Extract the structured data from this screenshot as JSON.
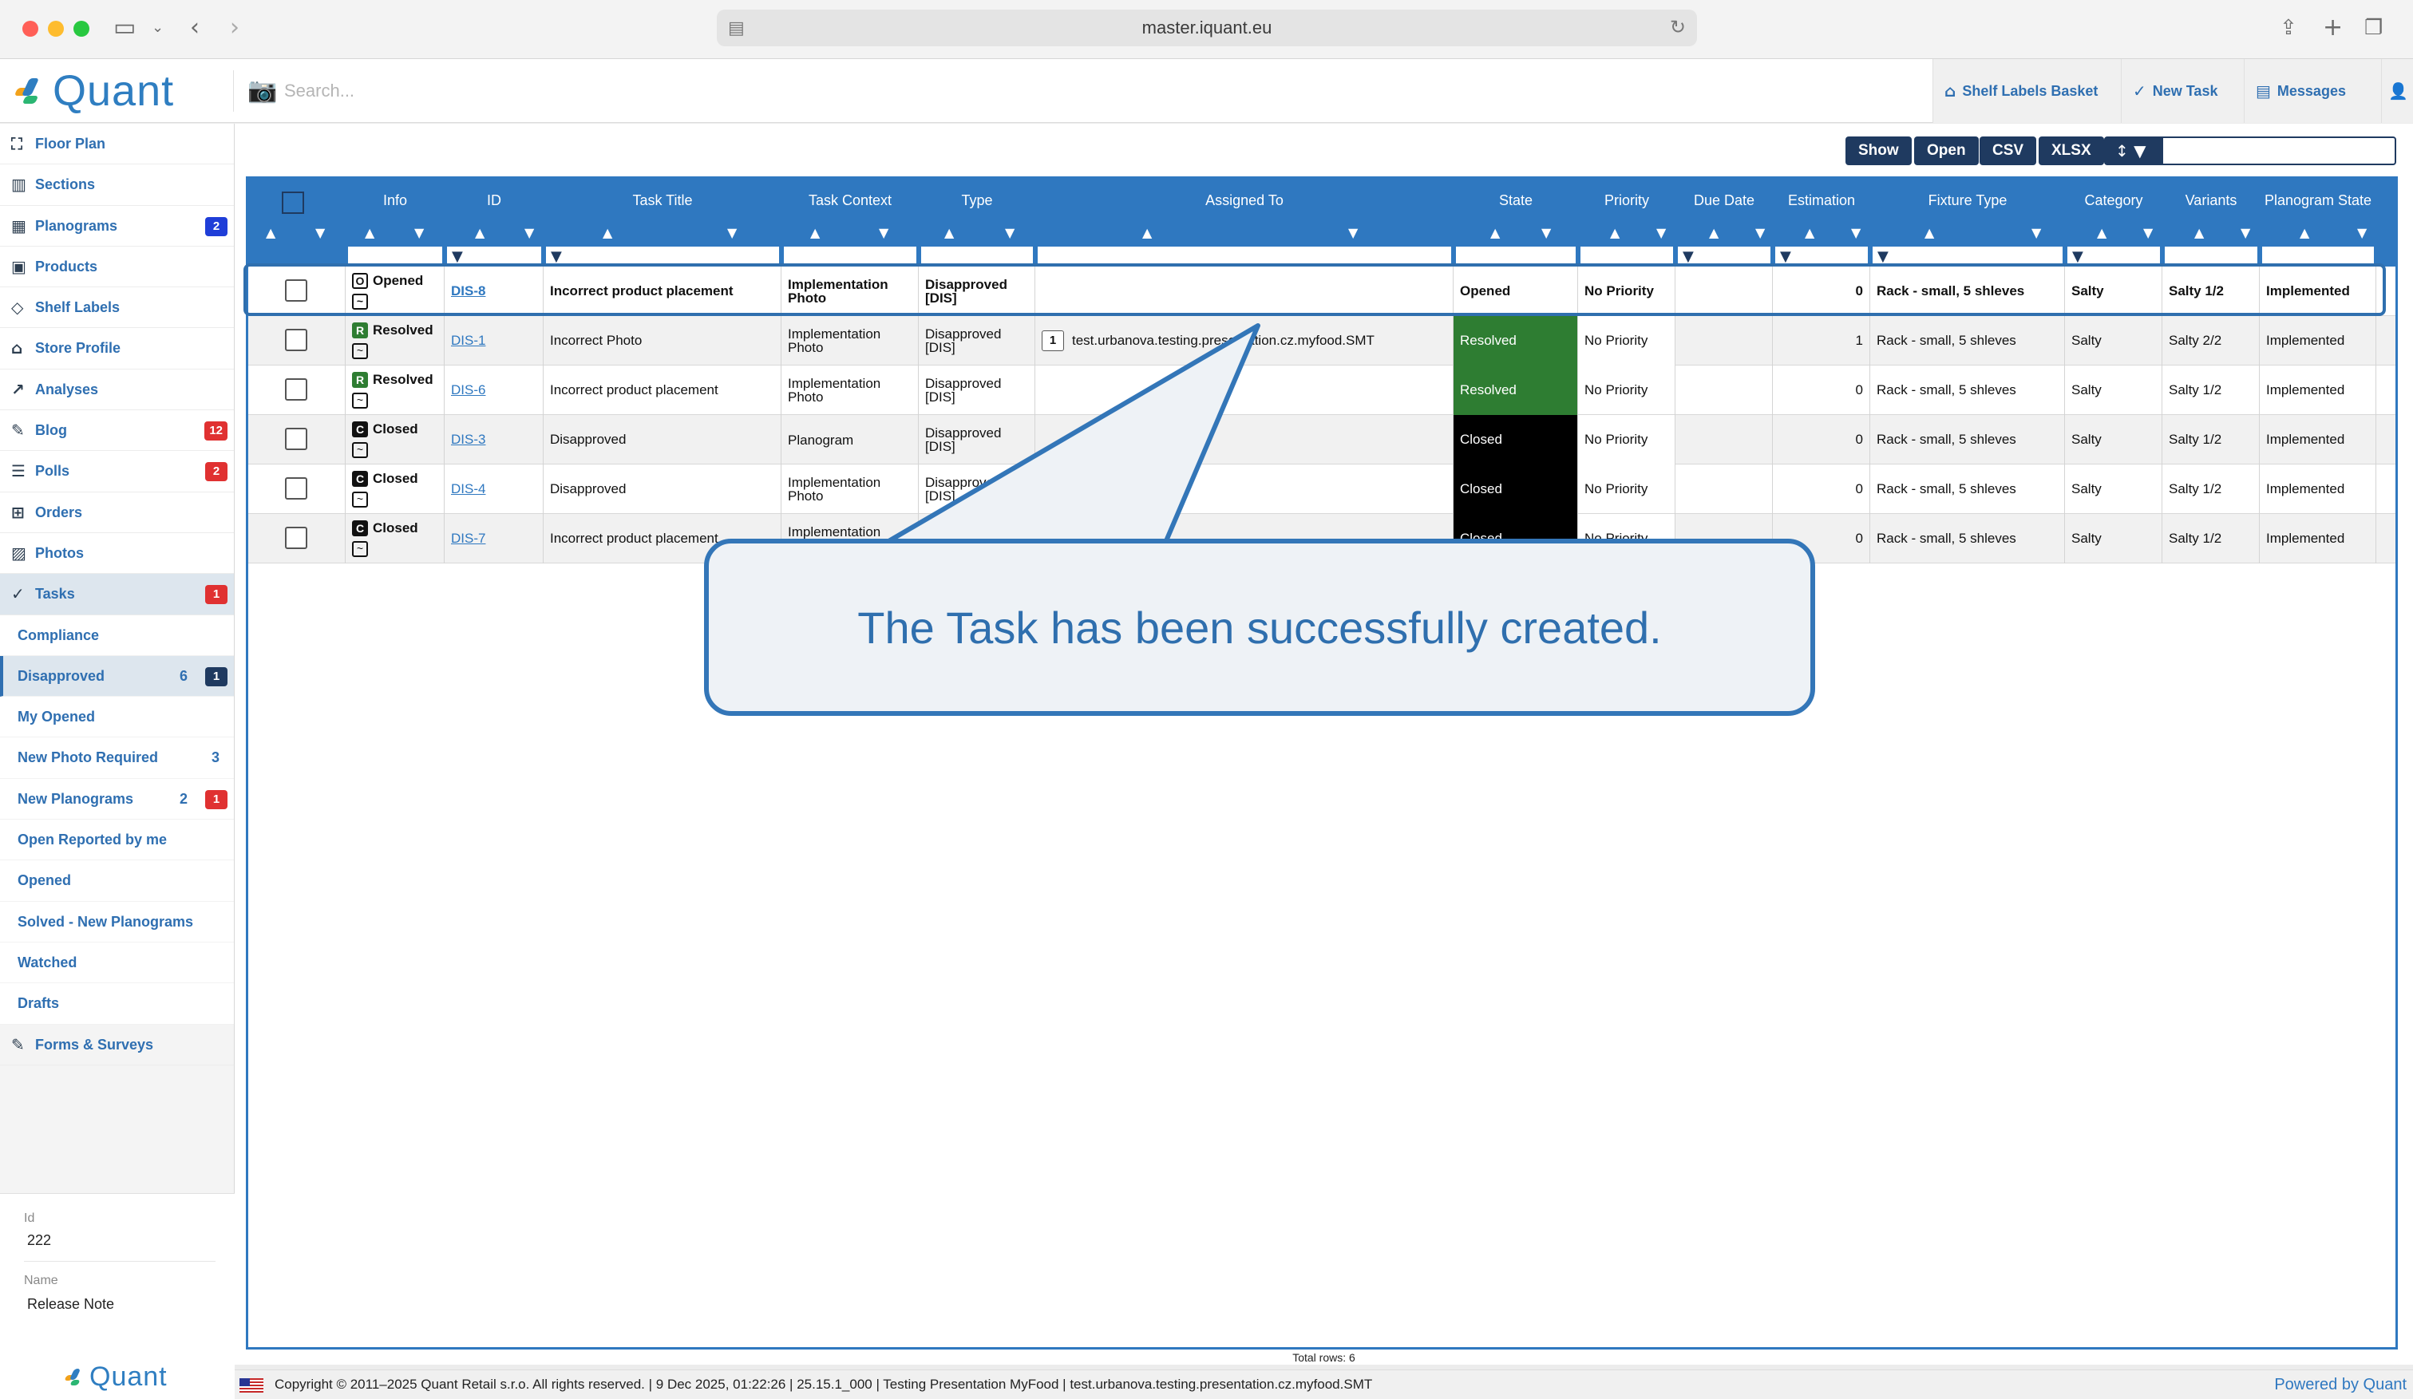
{
  "browser": {
    "url": "master.iquant.eu"
  },
  "app": {
    "logo_text": "Quant",
    "search_placeholder": "Search...",
    "header_buttons": [
      "Shelf Labels Basket",
      "New Task",
      "Messages"
    ]
  },
  "sidebar": {
    "items": [
      {
        "label": "Floor Plan",
        "icon": "floor-plan-icon"
      },
      {
        "label": "Sections",
        "icon": "sections-icon"
      },
      {
        "label": "Planograms",
        "icon": "planograms-icon",
        "badge": "2",
        "badge_color": "#1f3ed8"
      },
      {
        "label": "Products",
        "icon": "products-icon"
      },
      {
        "label": "Shelf Labels",
        "icon": "tag-icon"
      },
      {
        "label": "Store Profile",
        "icon": "store-icon"
      },
      {
        "label": "Analyses",
        "icon": "chart-icon"
      },
      {
        "label": "Blog",
        "icon": "blog-icon",
        "badge": "12",
        "badge_color": "#e03131"
      },
      {
        "label": "Polls",
        "icon": "polls-icon",
        "badge": "2",
        "badge_color": "#e03131"
      },
      {
        "label": "Orders",
        "icon": "orders-icon"
      },
      {
        "label": "Photos",
        "icon": "photos-icon"
      },
      {
        "label": "Tasks",
        "icon": "tasks-icon",
        "badge": "1",
        "badge_color": "#e03131"
      }
    ],
    "sub_items": [
      {
        "label": "Compliance"
      },
      {
        "label": "Disapproved",
        "count": "6",
        "badge": "1"
      },
      {
        "label": "My Opened"
      },
      {
        "label": "New Photo Required",
        "count": "3"
      },
      {
        "label": "New Planograms",
        "count": "2",
        "badge": "1"
      },
      {
        "label": "Open Reported by me"
      },
      {
        "label": "Opened"
      },
      {
        "label": "Solved - New Planograms"
      },
      {
        "label": "Watched"
      },
      {
        "label": "Drafts"
      }
    ],
    "after_items": [
      {
        "label": "Forms & Surveys",
        "icon": "forms-icon"
      }
    ],
    "footer": {
      "id_label": "Id",
      "id_value": "222",
      "name_label": "Name",
      "name_value": "Release Note",
      "logo_text": "Quant"
    }
  },
  "toolbar": {
    "buttons": [
      "Show",
      "Open",
      "CSV",
      "XLSX"
    ]
  },
  "grid": {
    "columns": [
      "Info",
      "ID",
      "Task Title",
      "Task Context",
      "Type",
      "Assigned To",
      "State",
      "Priority",
      "Due Date",
      "Estimation",
      "Fixture Type",
      "Category",
      "Variants",
      "Planogram State"
    ],
    "rows": [
      {
        "status": "Opened",
        "status_letter": "O",
        "id": "DIS-8",
        "title": "Incorrect product placement",
        "context": "Implementation Photo",
        "type": "Disapproved [DIS]",
        "assigned": "",
        "assigned_count": "",
        "state": "Opened",
        "priority": "No Priority",
        "due": "",
        "estimation": "0",
        "fixture": "Rack - small, 5 shleves",
        "category": "Salty",
        "variants": "Salty 1/2",
        "planogram_state": "Implemented"
      },
      {
        "status": "Resolved",
        "status_letter": "R",
        "id": "DIS-1",
        "title": "Incorrect Photo",
        "context": "Implementation Photo",
        "type": "Disapproved [DIS]",
        "assigned": "test.urbanova.testing.presentation.cz.myfood.SMT",
        "assigned_count": "1",
        "state": "Resolved",
        "priority": "No Priority",
        "due": "",
        "estimation": "1",
        "fixture": "Rack - small, 5 shleves",
        "category": "Salty",
        "variants": "Salty 2/2",
        "planogram_state": "Implemented"
      },
      {
        "status": "Resolved",
        "status_letter": "R",
        "id": "DIS-6",
        "title": "Incorrect product placement",
        "context": "Implementation Photo",
        "type": "Disapproved [DIS]",
        "assigned": "",
        "assigned_count": "",
        "state": "Resolved",
        "priority": "No Priority",
        "due": "",
        "estimation": "0",
        "fixture": "Rack - small, 5 shleves",
        "category": "Salty",
        "variants": "Salty 1/2",
        "planogram_state": "Implemented"
      },
      {
        "status": "Closed",
        "status_letter": "C",
        "id": "DIS-3",
        "title": "Disapproved",
        "context": "Planogram",
        "type": "Disapproved [DIS]",
        "assigned": "",
        "assigned_count": "",
        "state": "Closed",
        "priority": "No Priority",
        "due": "",
        "estimation": "0",
        "fixture": "Rack - small, 5 shleves",
        "category": "Salty",
        "variants": "Salty 1/2",
        "planogram_state": "Implemented"
      },
      {
        "status": "Closed",
        "status_letter": "C",
        "id": "DIS-4",
        "title": "Disapproved",
        "context": "Implementation Photo",
        "type": "Disapproved [DIS]",
        "assigned": "",
        "assigned_count": "",
        "state": "Closed",
        "priority": "No Priority",
        "due": "",
        "estimation": "0",
        "fixture": "Rack - small, 5 shleves",
        "category": "Salty",
        "variants": "Salty 1/2",
        "planogram_state": "Implemented"
      },
      {
        "status": "Closed",
        "status_letter": "C",
        "id": "DIS-7",
        "title": "Incorrect product placement",
        "context": "Implementation Photo",
        "type": "Disapproved [DIS]",
        "assigned": "",
        "assigned_count": "",
        "state": "Closed",
        "priority": "No Priority",
        "due": "",
        "estimation": "0",
        "fixture": "Rack - small, 5 shleves",
        "category": "Salty",
        "variants": "Salty 1/2",
        "planogram_state": "Implemented"
      }
    ],
    "total_rows": "Total rows: 6"
  },
  "callout": {
    "text": "The Task has been successfully created."
  },
  "footer": {
    "copyright": "Copyright © 2011–2025 Quant Retail s.r.o. All rights reserved. | 9 Dec 2025, 01:22:26 | 25.15.1_000 | Testing Presentation MyFood | test.urbanova.testing.presentation.cz.myfood.SMT",
    "powered": "Powered by Quant"
  },
  "colors": {
    "accent": "#2f78c0",
    "navy": "#1f3a60",
    "resolved": "#2e7d32",
    "closed": "#000000",
    "badge_red": "#e03131",
    "badge_blue": "#1f3ed8"
  }
}
